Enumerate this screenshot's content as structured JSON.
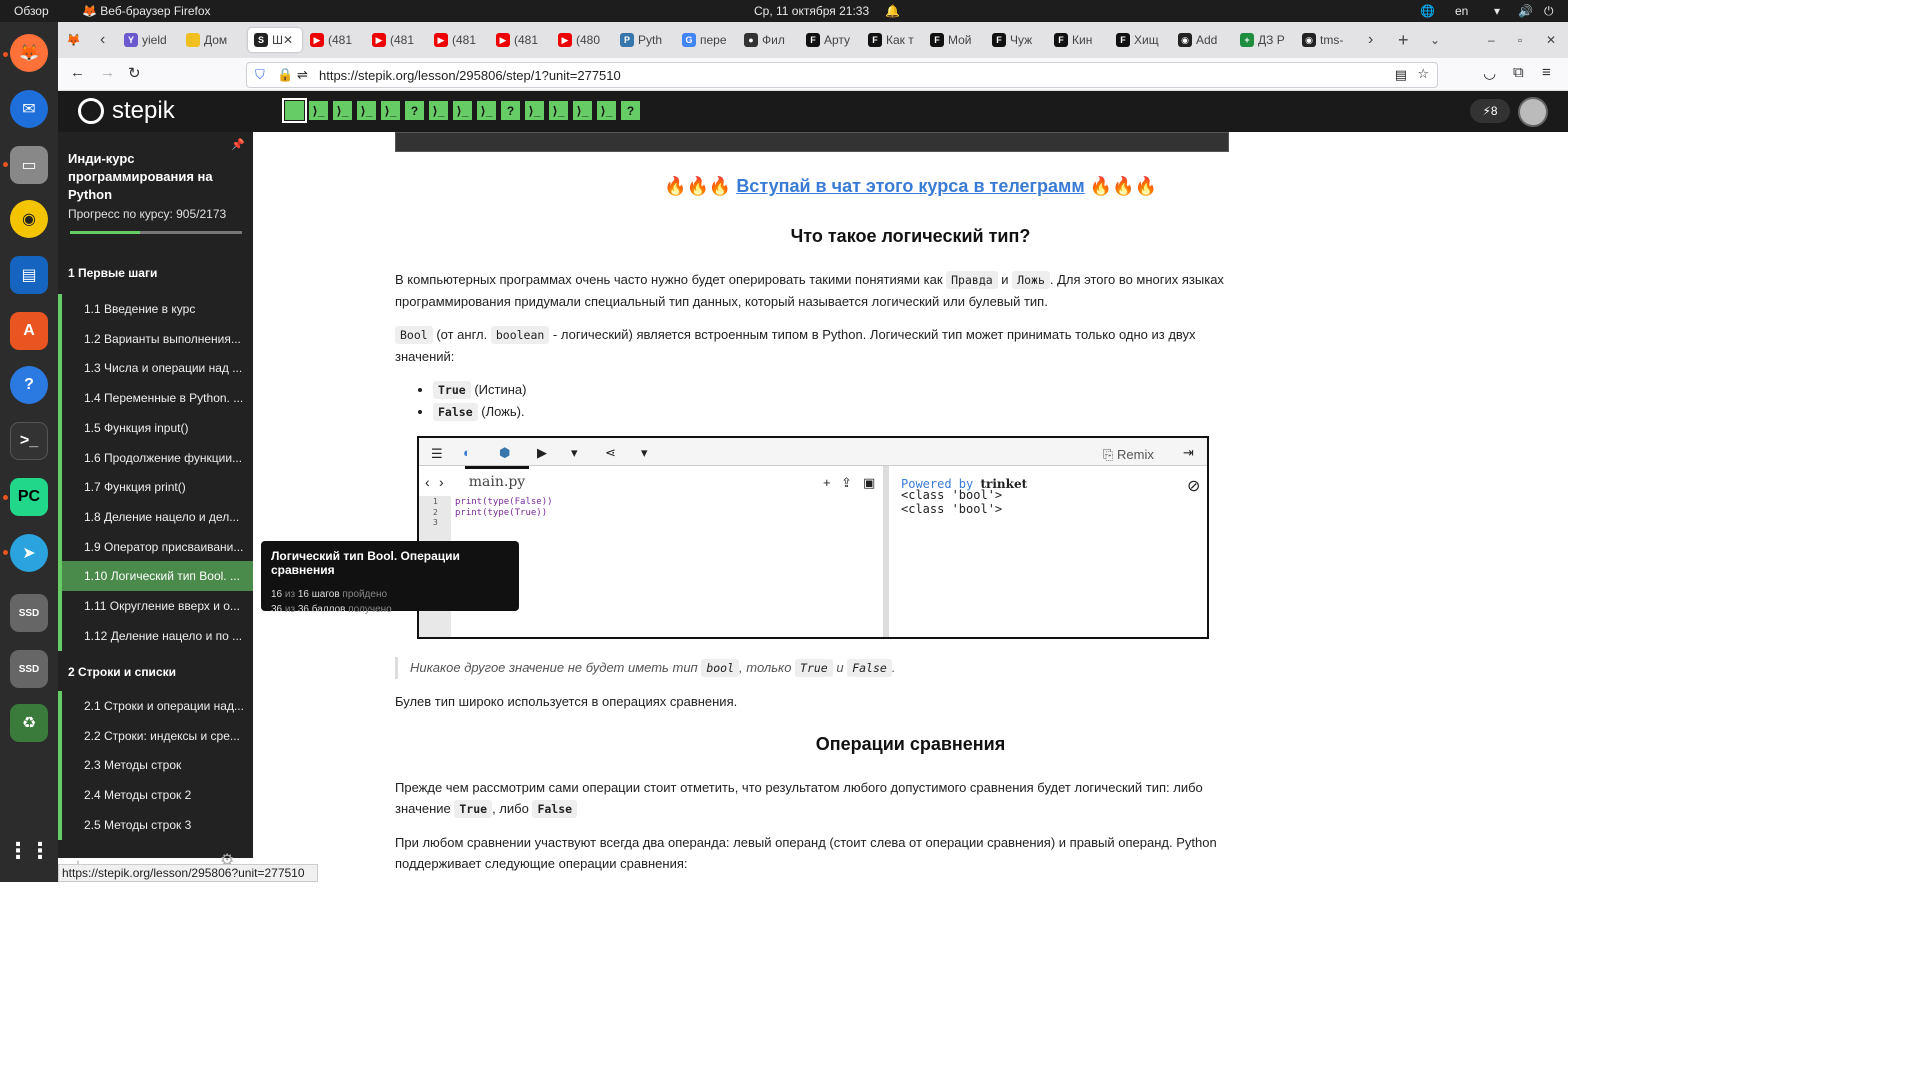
{
  "system": {
    "overview": "Обзор",
    "app_title": "Веб-браузер Firefox",
    "datetime": "Ср, 11 октября  21:33",
    "lang": "en"
  },
  "browser": {
    "tabs": [
      {
        "label": "yield",
        "color": "#6a5acd",
        "icon": "Y"
      },
      {
        "label": "Дом",
        "color": "#f0c020",
        "icon": ""
      },
      {
        "label": "Ш",
        "color": "#222",
        "icon": "S",
        "active": true
      },
      {
        "label": "(481",
        "color": "#e00",
        "icon": "▶"
      },
      {
        "label": "(481",
        "color": "#e00",
        "icon": "▶"
      },
      {
        "label": "(481",
        "color": "#e00",
        "icon": "▶"
      },
      {
        "label": "(481",
        "color": "#e00",
        "icon": "▶"
      },
      {
        "label": "(480",
        "color": "#e00",
        "icon": "▶"
      },
      {
        "label": "Pyth",
        "color": "#3776ab",
        "icon": "P"
      },
      {
        "label": "пере",
        "color": "#4285f4",
        "icon": "G"
      },
      {
        "label": "Фил",
        "color": "#333",
        "icon": "●"
      },
      {
        "label": "Арту",
        "color": "#111",
        "icon": "F"
      },
      {
        "label": "Как т",
        "color": "#111",
        "icon": "F"
      },
      {
        "label": "Мой",
        "color": "#111",
        "icon": "F"
      },
      {
        "label": "Чуж",
        "color": "#111",
        "icon": "F"
      },
      {
        "label": "Кин",
        "color": "#111",
        "icon": "F"
      },
      {
        "label": "Хищ",
        "color": "#111",
        "icon": "F"
      },
      {
        "label": "Add",
        "color": "#222",
        "icon": "◉"
      },
      {
        "label": "ДЗ Р",
        "color": "#1e8e3e",
        "icon": "+"
      },
      {
        "label": "tms-",
        "color": "#222",
        "icon": "◉"
      }
    ],
    "url": "https://stepik.org/lesson/295806/step/1?unit=277510",
    "status_url": "https://stepik.org/lesson/295806?unit=277510"
  },
  "stepik": {
    "logo": "stepik",
    "badge_count": "8",
    "steps": [
      "",
      "⟩_",
      "⟩_",
      "⟩_",
      "⟩_",
      "?",
      "⟩_",
      "⟩_",
      "⟩_",
      "?",
      "⟩_",
      "⟩_",
      "⟩_",
      "⟩_",
      "?"
    ]
  },
  "sidebar": {
    "course_title": "Инди-курс программирования на Python",
    "progress": "Прогресс по курсу:  905/2173",
    "section1": "1  Первые шаги",
    "lessons": [
      "1.1  Введение в курс",
      "1.2  Варианты выполнения...",
      "1.3  Числа и операции над ...",
      "1.4  Переменные в Python. ...",
      "1.5  Функция input()",
      "1.6  Продолжение функции...",
      "1.7  Функция print()",
      "1.8  Деление нацело и дел...",
      "1.9  Оператор присваивани...",
      "1.10  Логический тип Bool. ...",
      "1.11  Округление вверх и о...",
      "1.12  Деление нацело и по ..."
    ],
    "section2": "2  Строки и списки",
    "lessons2": [
      "2.1  Строки и операции над...",
      "2.2  Строки: индексы и сре...",
      "2.3  Методы строк",
      "2.4  Методы строк 2",
      "2.5  Методы строк 3"
    ]
  },
  "tooltip": {
    "title": "Логический тип Bool. Операции сравнения",
    "l1a": "16",
    "l1b": " из ",
    "l1c": "16 шагов",
    "l1d": " пройдено",
    "l2a": "36",
    "l2b": " из ",
    "l2c": "36 баллов",
    "l2d": " получено"
  },
  "content": {
    "telegram": "Вступай в чат этого курса в телеграмм",
    "h_bool": "Что такое логический тип?",
    "p1a": "В компьютерных программах очень часто нужно будет оперировать такими понятиями как ",
    "c_true_ru": "Правда",
    "and": " и ",
    "c_false_ru": "Ложь",
    "p1b": ". Для этого во многих языках программирования придумали специальный тип данных, который называется логический или булевый тип.",
    "c_bool": "Bool",
    "p2a": " (от англ. ",
    "c_boolean": "boolean",
    "p2b": " - логический) является встроенным типом в Python. Логический тип может принимать только одно из двух значений:",
    "li_true": "True",
    "li_true_t": " (Истина)",
    "li_false": "False",
    "li_false_t": " (Ложь).",
    "q_a": "Никакое другое значение не будет иметь тип ",
    "q_bool": "bool",
    "q_b": ", только ",
    "q_true": "True",
    "q_and": " и ",
    "q_false": "False",
    "q_end": ".",
    "p3": "Булев тип широко используется в операциях сравнения.",
    "h_ops": "Операции сравнения",
    "p4a": "Прежде чем рассмотрим сами операции стоит отметить, что результатом любого допустимого сравнения будет логический тип: либо значение ",
    "p4_true": "True",
    "p4_or": ", либо ",
    "p4_false": "False",
    "p5": "При любом сравнении участвуют всегда два операнда: левый операнд (стоит слева от операции сравнения) и правый операнд. Python поддерживает следующие операции сравнения:"
  },
  "trinket": {
    "file": "main.py",
    "remix": "Remix",
    "powered": "Powered by ",
    "brand": "trinket",
    "code": [
      "print(type(False))",
      "print(type(True))",
      ""
    ],
    "output": [
      "<class 'bool'>",
      "<class 'bool'>"
    ]
  }
}
